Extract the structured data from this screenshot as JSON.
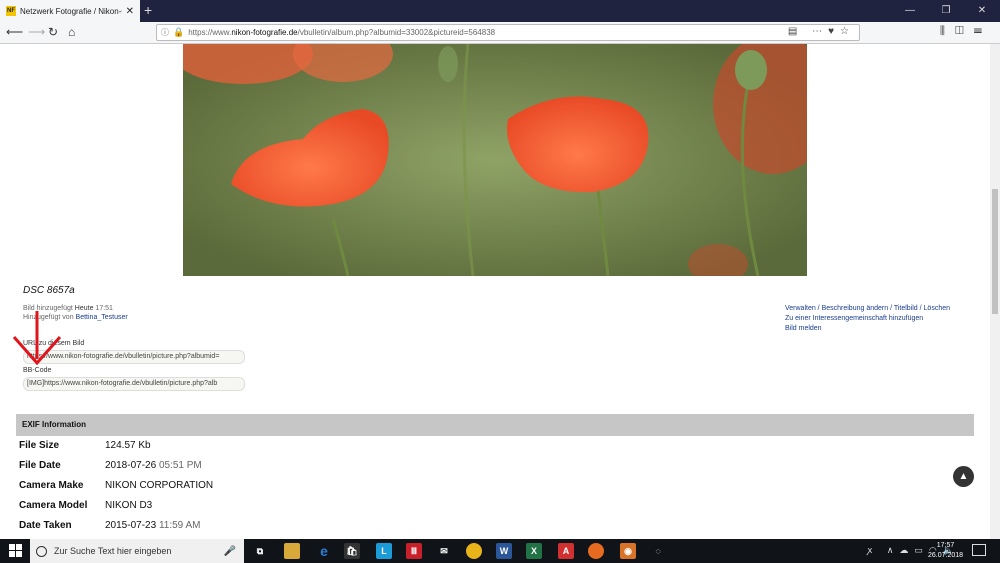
{
  "browser": {
    "tab_title": "Netzwerk Fotografie / Nikon-C",
    "tab_favicon_text": "NF",
    "url_prefix": "https://www.",
    "url_domain": "nikon-fotografie.de",
    "url_path": "/vbulletin/album.php?albumid=33002&pictureid=564838"
  },
  "picture": {
    "title": "DSC 8657a",
    "added_label": "Bild hinzugefügt",
    "added_date": "Heute",
    "added_time": "17:51",
    "added_by_label": "Hinzugefügt von",
    "added_by_user": "Bettina_Testuser"
  },
  "actions": {
    "line1": "Verwalten / Beschreibung ändern / Titelbild / Löschen",
    "line2": "Zu einer Interessengemeinschaft hinzufügen",
    "line3": "Bild melden"
  },
  "links": {
    "url_label": "URL zu diesem Bild",
    "url_value": "https://www.nikon-fotografie.de/vbulletin/picture.php?albumid=",
    "bbcode_label": "BB-Code",
    "bbcode_value": "[IMG]https://www.nikon-fotografie.de/vbulletin/picture.php?alb"
  },
  "exif": {
    "header": "EXIF Information",
    "rows": [
      {
        "key": "File Size",
        "value": "124.57 Kb",
        "time": ""
      },
      {
        "key": "File Date",
        "value": "2018-07-26",
        "time": "05:51 PM"
      },
      {
        "key": "Camera Make",
        "value": "NIKON CORPORATION",
        "time": ""
      },
      {
        "key": "Camera Model",
        "value": "NIKON D3",
        "time": ""
      },
      {
        "key": "Date Taken",
        "value": "2015-07-23",
        "time": "11:59 AM"
      }
    ]
  },
  "taskbar": {
    "search_placeholder": "Zur Suche Text hier eingeben",
    "time": "17:57",
    "date": "26.07.2018"
  },
  "colors": {
    "link": "#1a3d8f",
    "exif_header_bg": "#c6c6c6",
    "annotation_arrow": "#e0141b"
  }
}
